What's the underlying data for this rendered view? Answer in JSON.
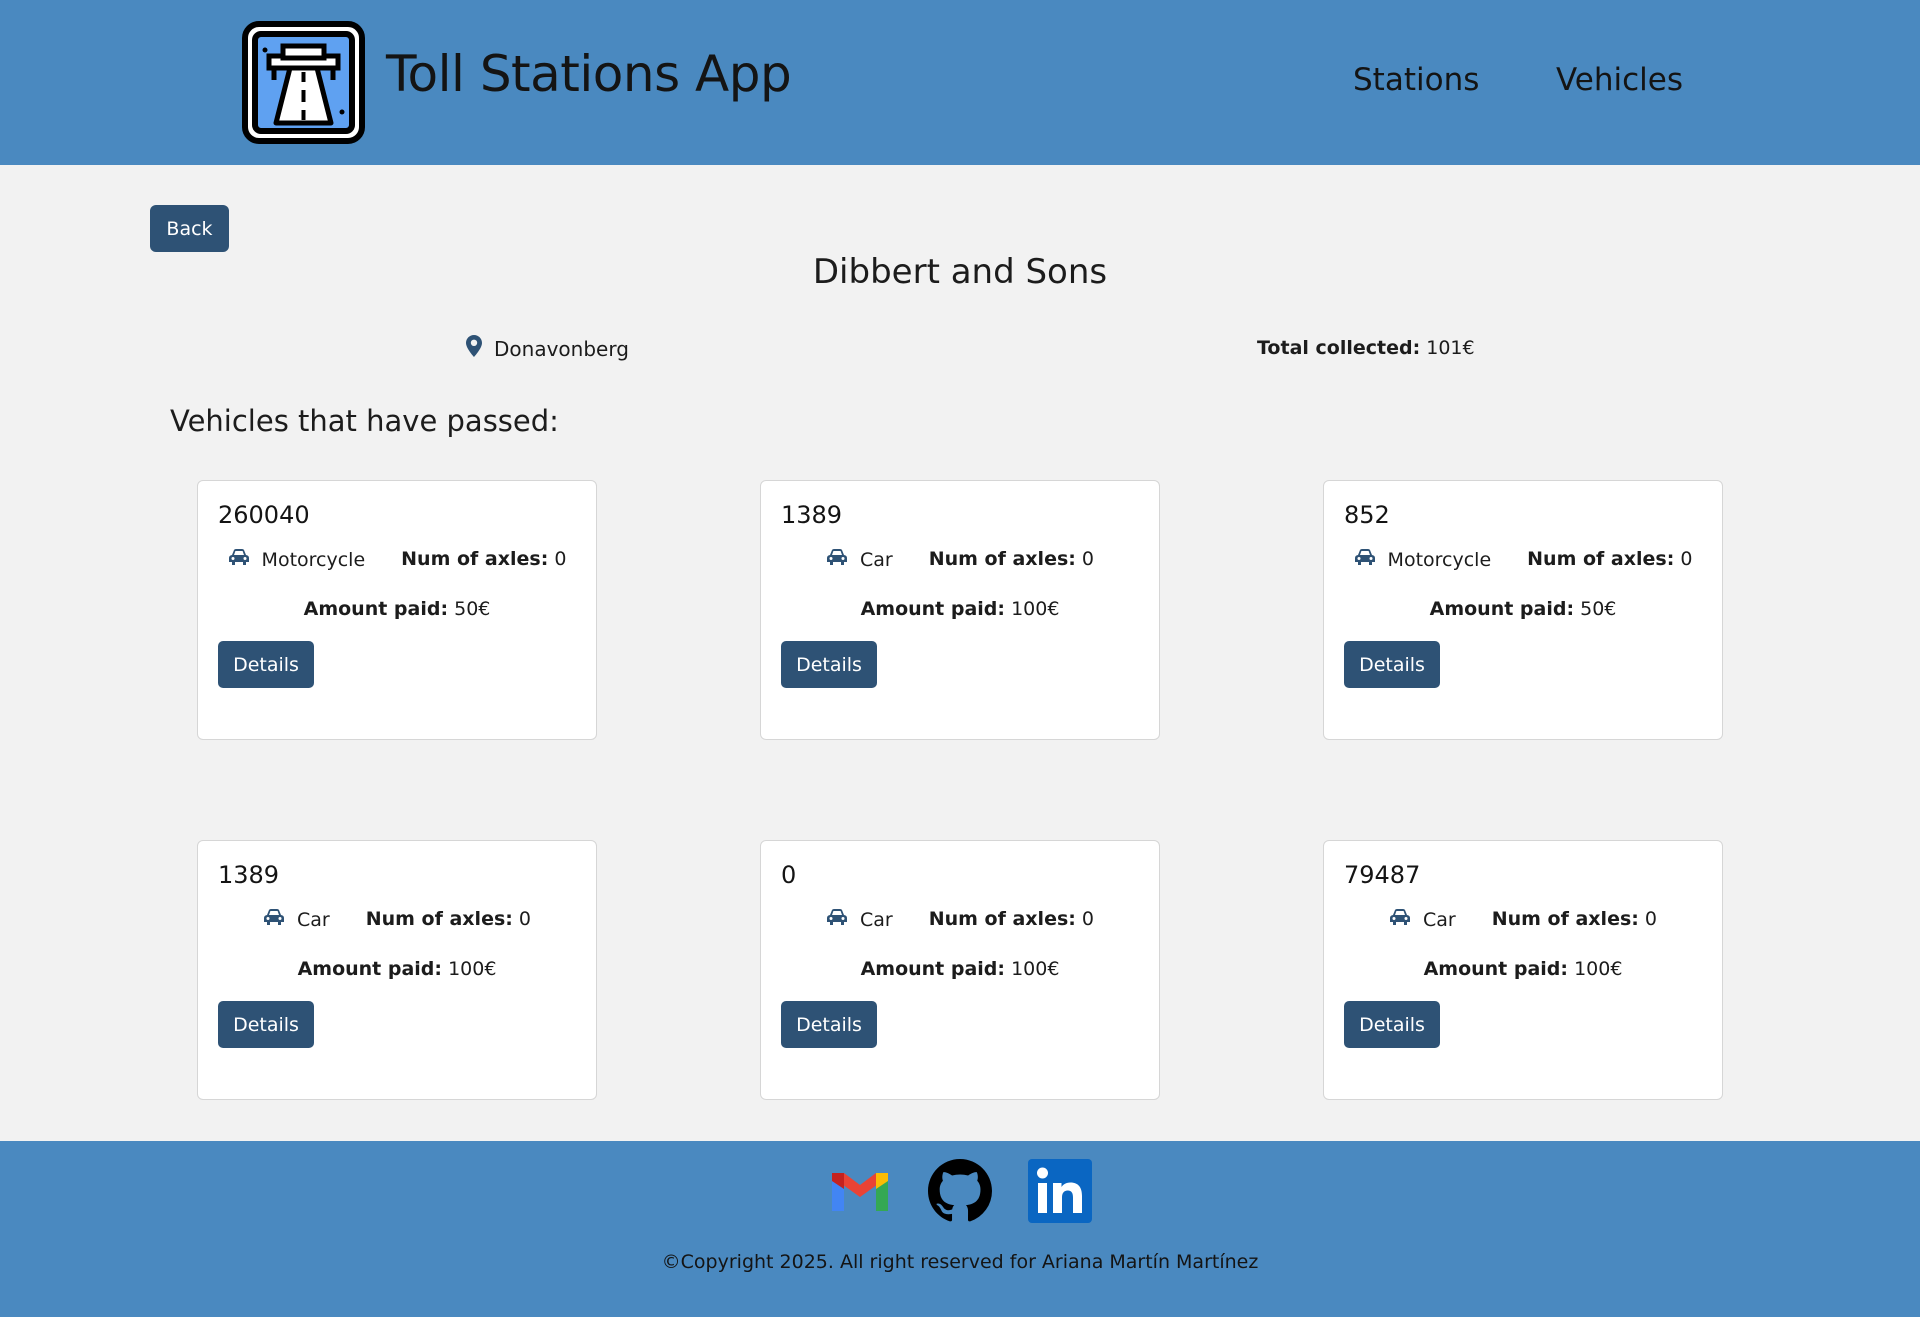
{
  "header": {
    "title": "Toll Stations App",
    "nav": [
      {
        "label": "Stations"
      },
      {
        "label": "Vehicles"
      }
    ],
    "logo_icon": "highway-icon"
  },
  "main": {
    "back_label": "Back",
    "station_name": "Dibbert and Sons",
    "location": "Donavonberg",
    "total_label": "Total collected:",
    "total_value": "101€",
    "section_title": "Vehicles that have passed:",
    "vehicles": [
      {
        "id": "260040",
        "type": "Motorcycle",
        "axles_label": "Num of axles:",
        "axles": "0",
        "amount_label": "Amount paid:",
        "amount": "50€",
        "details_label": "Details"
      },
      {
        "id": "1389",
        "type": "Car",
        "axles_label": "Num of axles:",
        "axles": "0",
        "amount_label": "Amount paid:",
        "amount": "100€",
        "details_label": "Details"
      },
      {
        "id": "852",
        "type": "Motorcycle",
        "axles_label": "Num of axles:",
        "axles": "0",
        "amount_label": "Amount paid:",
        "amount": "50€",
        "details_label": "Details"
      },
      {
        "id": "1389",
        "type": "Car",
        "axles_label": "Num of axles:",
        "axles": "0",
        "amount_label": "Amount paid:",
        "amount": "100€",
        "details_label": "Details"
      },
      {
        "id": "0",
        "type": "Car",
        "axles_label": "Num of axles:",
        "axles": "0",
        "amount_label": "Amount paid:",
        "amount": "100€",
        "details_label": "Details"
      },
      {
        "id": "79487",
        "type": "Car",
        "axles_label": "Num of axles:",
        "axles": "0",
        "amount_label": "Amount paid:",
        "amount": "100€",
        "details_label": "Details"
      }
    ]
  },
  "footer": {
    "social": [
      "gmail-icon",
      "github-icon",
      "linkedin-icon"
    ],
    "copyright": "©Copyright 2025. All right reserved for Ariana Martín Martínez"
  },
  "colors": {
    "header_bg": "#4a89c0",
    "button_bg": "#2e5275",
    "page_bg": "#f2f2f2"
  }
}
